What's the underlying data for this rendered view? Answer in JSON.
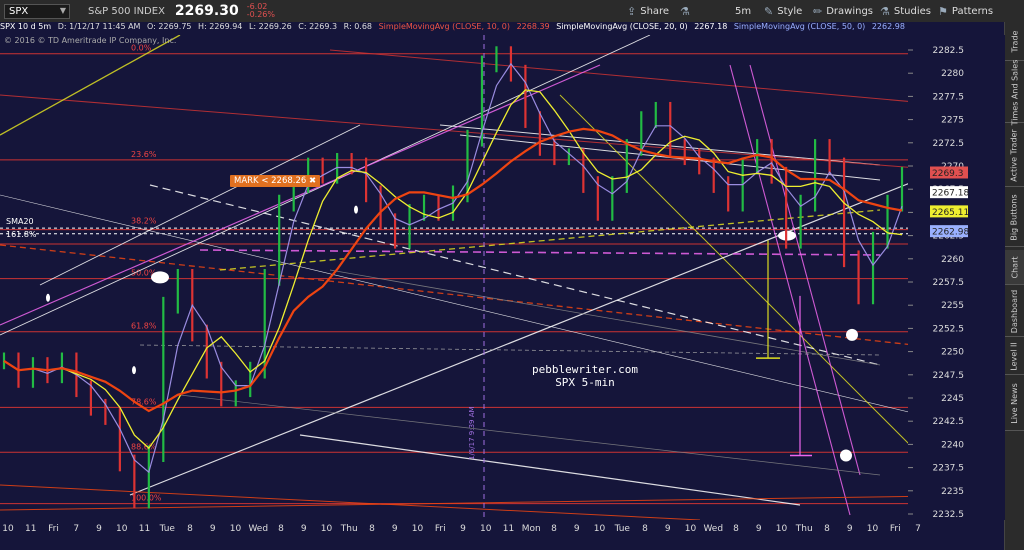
{
  "toolbar": {
    "symbol": "SPX",
    "index_name": "S&P 500 INDEX",
    "last_price": "2269.30",
    "change_abs": "-6.02",
    "change_pct": "-0.26%",
    "share_label": "Share",
    "timeframe_label": "5m",
    "style_label": "Style",
    "drawings_label": "Drawings",
    "studies_label": "Studies",
    "patterns_label": "Patterns"
  },
  "infobar": {
    "title": "SPX 10 d 5m",
    "d": "D: 1/12/17 11:45 AM",
    "o": "O: 2269.75",
    "h": "H: 2269.94",
    "l": "L: 2269.26",
    "c": "C: 2269.3",
    "r": "R: 0.68",
    "sma10": "SimpleMovingAvg (CLOSE, 10, 0)",
    "sma10_val": "2268.39",
    "sma20": "SimpleMovingAvg (CLOSE, 20, 0)",
    "sma20_val": "2267.18",
    "sma50": "SimpleMovingAvg (CLOSE, 50, 0)",
    "sma50_val": "2262.98"
  },
  "copyright": "© 2016 © TD Ameritrade IP Company, Inc.",
  "right_tabs": [
    "Trade",
    "Times And Sales",
    "Active Trader",
    "Big Buttons",
    "Chart",
    "Dashboard",
    "Level II",
    "Live News"
  ],
  "watermark": {
    "line1": "pebblewriter.com",
    "line2": "SPX 5-min"
  },
  "mark_label": "MARK < 2268.26",
  "sma20_label": "SMA20",
  "fib161_label": "161.8%",
  "date_annotation": "1/6/17 9:39 AM",
  "colors": {
    "background": "#15153a",
    "price_bar_up": "#22bb44",
    "price_bar_down": "#dd3333",
    "sma10": "#9a8ce0",
    "sma20": "#eeee30",
    "sma50": "#ee4411",
    "fib_line": "#cc3333",
    "trend_white": "#ffffff",
    "magenta": "#ee66ee",
    "yellow_line": "#dddd22",
    "price_tag": "#e05050",
    "sma20_tag": "#eeee30",
    "sma50_tag": "#9ab0ff"
  },
  "chart_data": {
    "type": "line",
    "title": "SPX 10 d 5m",
    "y_range": [
      2231.5,
      2284.5
    ],
    "y_ticks": [
      2282.5,
      2280,
      2277.5,
      2275,
      2272.5,
      2270,
      2267.5,
      2265,
      2262.5,
      2260,
      2257.5,
      2255,
      2252.5,
      2250,
      2247.5,
      2245,
      2242.5,
      2240,
      2237.5,
      2235,
      2232.5
    ],
    "y_tick_labels": [
      "2282.5",
      "2280",
      "2277.5",
      "2275",
      "2272.5",
      "2270",
      "2267.5",
      "2265",
      "2262.5",
      "2260",
      "2257.5",
      "2255",
      "2252.5",
      "2250",
      "2247.5",
      "2245",
      "2242.5",
      "2240",
      "2237.5",
      "2235",
      "2232.5"
    ],
    "x_tick_labels": [
      "10",
      "11",
      "Fri",
      "7",
      "9",
      "10",
      "11",
      "Tue",
      "8",
      "9",
      "10",
      "Wed",
      "8",
      "9",
      "10",
      "Thu",
      "8",
      "9",
      "10",
      "Fri",
      "9",
      "10",
      "11",
      "Mon",
      "8",
      "9",
      "10",
      "Tue",
      "8",
      "9",
      "10",
      "Wed",
      "8",
      "9",
      "10",
      "Thu",
      "8",
      "9",
      "10",
      "Fri",
      "7"
    ],
    "series": [
      {
        "name": "SPX",
        "values": [
          2249,
          2247,
          2248.5,
          2247.5,
          2249,
          2246,
          2244,
          2243,
          2238,
          2234,
          2239,
          2255,
          2258,
          2252,
          2248,
          2245,
          2246,
          2248,
          2258,
          2266,
          2268,
          2270,
          2269,
          2270.5,
          2270,
          2267,
          2264,
          2262,
          2265,
          2266,
          2265,
          2267,
          2273,
          2281,
          2282,
          2280,
          2275,
          2272,
          2271,
          2271,
          2268,
          2265,
          2268,
          2272,
          2275,
          2276,
          2272,
          2271,
          2270,
          2268,
          2266,
          2270,
          2272,
          2269,
          2262,
          2266,
          2272,
          2270,
          2260,
          2256,
          2262,
          2266,
          2269
        ]
      }
    ],
    "price_levels": [
      {
        "value": "2282.1",
        "y": 2282.1
      },
      {
        "value": "2270.66",
        "y": 2270.66
      },
      {
        "value": "2263.14",
        "y": 2263.14
      },
      {
        "value": "2261.6",
        "y": 2261.6
      },
      {
        "value": "2257.86",
        "y": 2257.86
      },
      {
        "value": "2252.14",
        "y": 2252.14
      },
      {
        "value": "2243.99",
        "y": 2243.99
      },
      {
        "value": "2239.15",
        "y": 2239.15
      },
      {
        "value": "2233.62",
        "y": 2233.62
      }
    ],
    "fib_labels": [
      {
        "label": "0.0%",
        "y": 2282.1
      },
      {
        "label": "23.6%",
        "y": 2270.66
      },
      {
        "label": "38.2%",
        "y": 2263.5
      },
      {
        "label": "50.0%",
        "y": 2257.86
      },
      {
        "label": "61.8%",
        "y": 2252.14
      },
      {
        "label": "78.6%",
        "y": 2243.99
      },
      {
        "label": "88.6%",
        "y": 2239.15
      },
      {
        "label": "100.0%",
        "y": 2233.62
      }
    ],
    "tags": [
      {
        "value": "2269.3",
        "y": 2269.3,
        "kind": "price"
      },
      {
        "value": "2267.18",
        "y": 2267.18,
        "kind": "sma10"
      },
      {
        "value": "2265.11",
        "y": 2265.11,
        "kind": "sma20"
      },
      {
        "value": "2262.98",
        "y": 2262.98,
        "kind": "sma50"
      }
    ]
  }
}
